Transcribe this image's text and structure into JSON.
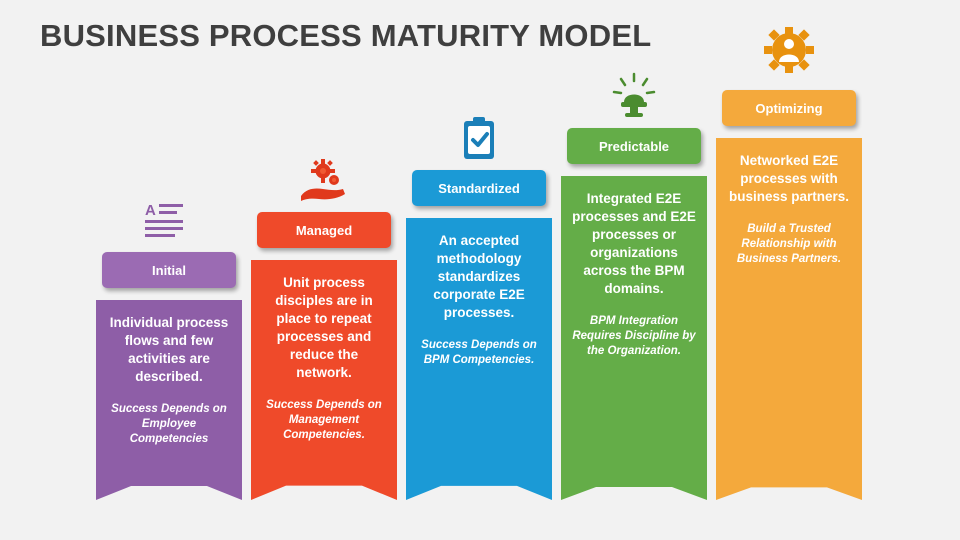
{
  "title": "BUSINESS PROCESS MATURITY MODEL",
  "background": "#f2f2f2",
  "title_color": "#3f3f3f",
  "levels": [
    {
      "name": "Initial",
      "color": "#8e5ea7",
      "chip_color": "#9b6bb3",
      "icon": "text-lines-icon",
      "body": "Individual process flows and few activities are described.",
      "note": "Success Depends on Employee Competencies"
    },
    {
      "name": "Managed",
      "color": "#ef4a2a",
      "chip_color": "#ef4a2a",
      "icon": "hand-gears-icon",
      "body": "Unit process disciples are in place to repeat processes and reduce the network.",
      "note": "Success Depends on Management Competencies."
    },
    {
      "name": "Standardized",
      "color": "#1b9ad6",
      "chip_color": "#1b9ad6",
      "icon": "clipboard-check-icon",
      "body": "An accepted methodology standardizes corporate E2E processes.",
      "note": "Success Depends on BPM Competencies."
    },
    {
      "name": "Predictable",
      "color": "#64ad48",
      "chip_color": "#64ad48",
      "icon": "idea-lamp-icon",
      "body": "Integrated E2E processes and E2E processes or organizations across the BPM domains.",
      "note": "BPM Integration Requires Discipline by the Organization."
    },
    {
      "name": "Optimizing",
      "color": "#f4a93c",
      "chip_color": "#f4a93c",
      "icon": "gear-person-icon",
      "body": "Networked E2E processes with business partners.",
      "note": "Build a Trusted Relationship with Business Partners."
    }
  ]
}
